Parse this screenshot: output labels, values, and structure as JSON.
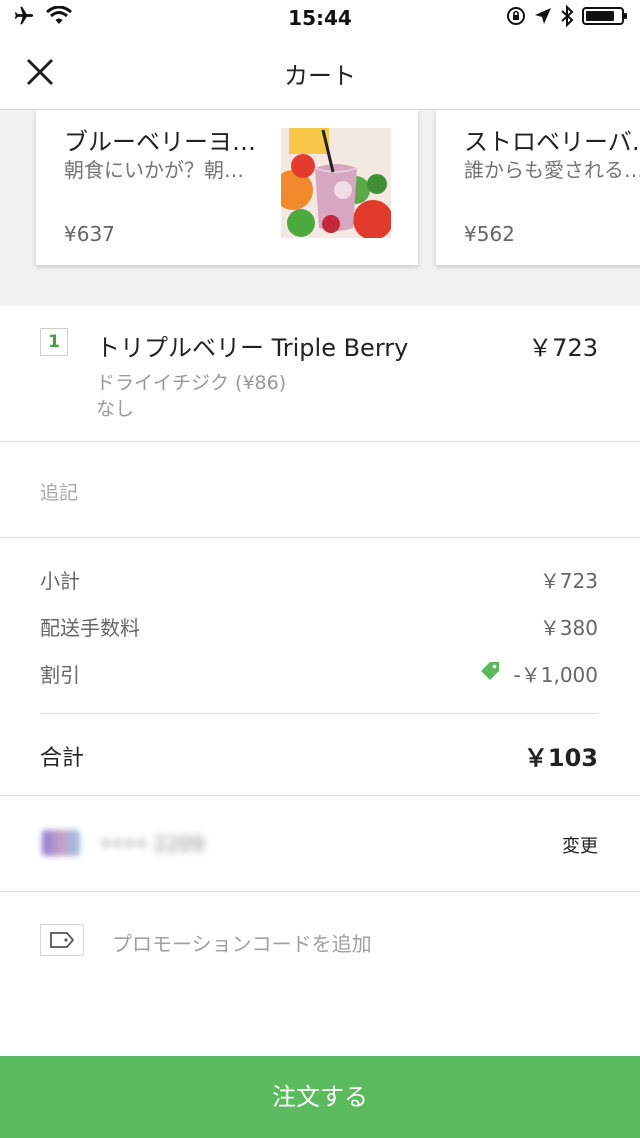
{
  "status_bar": {
    "time": "15:44"
  },
  "header": {
    "title": "カート"
  },
  "suggestions": [
    {
      "title": "ブルーベリーヨ…",
      "description": "朝食にいかが？朝…",
      "price": "¥637"
    },
    {
      "title": "ストロベリーバ…",
      "description": "誰からも愛される…",
      "price": "¥562"
    }
  ],
  "cart_item": {
    "quantity": "1",
    "name": "トリプルベリー Triple Berry",
    "price": "￥723",
    "options": [
      "ドライイチジク (¥86)",
      "なし"
    ]
  },
  "notes": {
    "placeholder": "追記"
  },
  "summary": {
    "subtotal_label": "小計",
    "subtotal_value": "￥723",
    "delivery_label": "配送手数料",
    "delivery_value": "￥380",
    "discount_label": "割引",
    "discount_value": "-￥1,000",
    "total_label": "合計",
    "total_value": "￥103"
  },
  "payment": {
    "card_number": "•••• 2209",
    "change_label": "変更"
  },
  "promo": {
    "label": "プロモーションコードを追加"
  },
  "order_button": {
    "label": "注文する"
  },
  "colors": {
    "accent_green": "#5cba5e",
    "tag_green": "#5cb85c"
  },
  "icons": {
    "airplane": "airplane-icon",
    "wifi": "wifi-icon",
    "rotation_lock": "rotation-lock-icon",
    "location": "location-arrow-icon",
    "bluetooth": "bluetooth-icon",
    "battery": "battery-icon",
    "close": "close-icon",
    "discount_tag": "price-tag-icon",
    "promo": "promo-tag-icon"
  }
}
